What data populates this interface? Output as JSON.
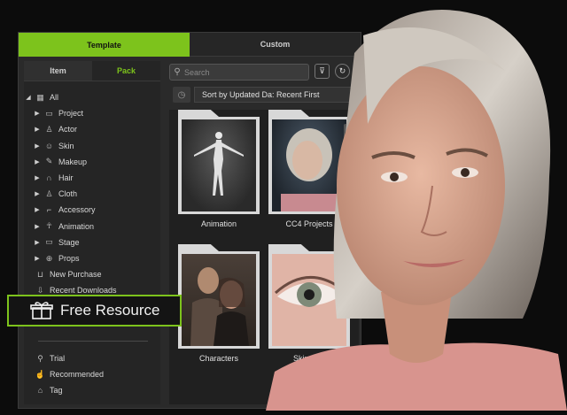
{
  "top_tabs": {
    "template": "Template",
    "custom": "Custom"
  },
  "side_tabs": {
    "item": "Item",
    "pack": "Pack"
  },
  "tree": [
    {
      "label": "All",
      "icon": "grid-icon",
      "glyph": "▦"
    },
    {
      "label": "Project",
      "icon": "folder-icon",
      "glyph": "▭"
    },
    {
      "label": "Actor",
      "icon": "actor-icon",
      "glyph": "♙"
    },
    {
      "label": "Skin",
      "icon": "skin-icon",
      "glyph": "☺"
    },
    {
      "label": "Makeup",
      "icon": "makeup-icon",
      "glyph": "✎"
    },
    {
      "label": "Hair",
      "icon": "hair-icon",
      "glyph": "∩"
    },
    {
      "label": "Cloth",
      "icon": "cloth-icon",
      "glyph": "♙"
    },
    {
      "label": "Accessory",
      "icon": "accessory-icon",
      "glyph": "⌐"
    },
    {
      "label": "Animation",
      "icon": "animation-icon",
      "glyph": "☥"
    },
    {
      "label": "Stage",
      "icon": "stage-icon",
      "glyph": "▭"
    },
    {
      "label": "Props",
      "icon": "props-icon",
      "glyph": "⊕"
    }
  ],
  "extra_items": [
    {
      "label": "New Purchase",
      "icon": "cart-icon",
      "glyph": "⊔"
    },
    {
      "label": "Recent Downloads",
      "icon": "download-icon",
      "glyph": "⇩"
    }
  ],
  "bottom_items": [
    {
      "label": "Trial",
      "icon": "trial-icon",
      "glyph": "⚲"
    },
    {
      "label": "Recommended",
      "icon": "thumbs-up-icon",
      "glyph": "☝"
    },
    {
      "label": "Tag",
      "icon": "tag-icon",
      "glyph": "⌂"
    }
  ],
  "search": {
    "placeholder": "Search"
  },
  "sort": {
    "label": "Sort by Updated Da: Recent First"
  },
  "cards": [
    {
      "label": "Animation"
    },
    {
      "label": "CC4 Projects"
    },
    {
      "label": "Characters"
    },
    {
      "label": "Skin & M"
    }
  ],
  "badge": {
    "label": "Free Resource"
  },
  "colors": {
    "accent": "#7dc31c",
    "panel": "#2a2a2a",
    "background": "#0c0c0c"
  }
}
